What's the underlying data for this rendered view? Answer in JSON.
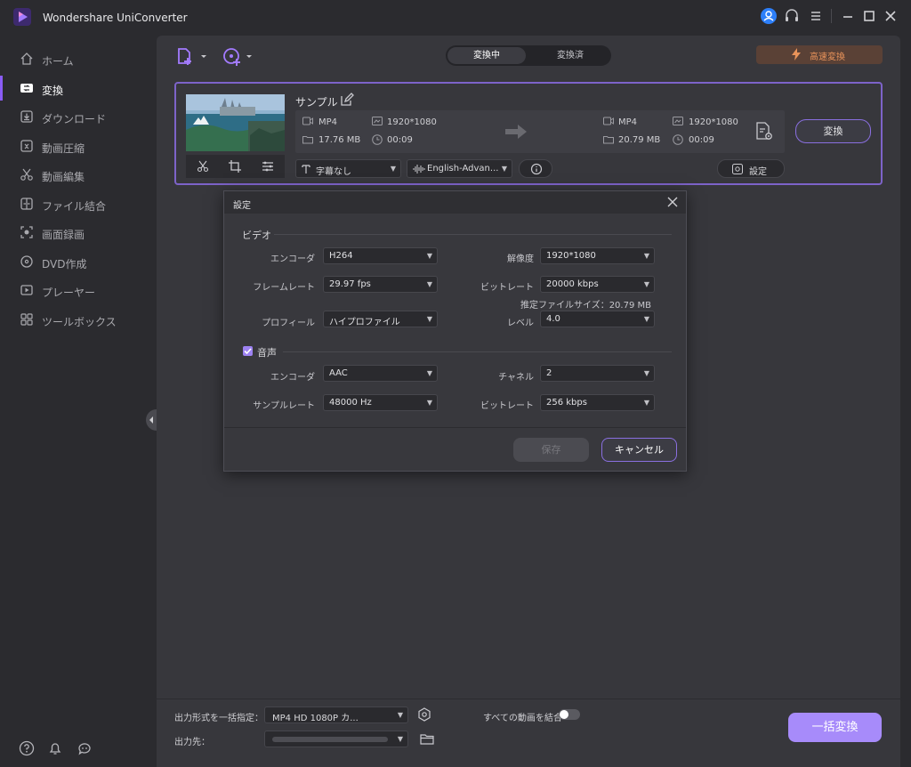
{
  "app": {
    "title": "Wondershare UniConverter"
  },
  "titlebar_icons": [
    "user-icon",
    "headset-icon",
    "menu-icon",
    "minimize-icon",
    "maximize-icon",
    "close-icon"
  ],
  "sidebar": {
    "items": [
      {
        "label": "ホーム",
        "icon": "home-icon"
      },
      {
        "label": "変換",
        "icon": "convert-icon",
        "active": true
      },
      {
        "label": "ダウンロード",
        "icon": "download-icon"
      },
      {
        "label": "動画圧縮",
        "icon": "compress-icon"
      },
      {
        "label": "動画編集",
        "icon": "scissors-icon"
      },
      {
        "label": "ファイル結合",
        "icon": "merge-icon"
      },
      {
        "label": "画面録画",
        "icon": "record-icon"
      },
      {
        "label": "DVD作成",
        "icon": "dvd-icon"
      },
      {
        "label": "プレーヤー",
        "icon": "player-icon"
      },
      {
        "label": "ツールボックス",
        "icon": "toolbox-icon"
      }
    ],
    "bottom_icons": [
      "help-icon",
      "bell-icon",
      "feedback-icon"
    ]
  },
  "toolbar": {
    "tabs": [
      "変換中",
      "変換済"
    ],
    "active_tab": "変換中",
    "turbo_label": "高速変換",
    "accent": "#8a5cf5",
    "turbo_color": "#e8935a"
  },
  "file": {
    "name": "サンプル",
    "source": {
      "format": "MP4",
      "resolution": "1920*1080",
      "size": "17.76 MB",
      "duration": "00:09"
    },
    "target": {
      "format": "MP4",
      "resolution": "1920*1080",
      "size": "20.79 MB",
      "duration": "00:09"
    },
    "convert_label": "変換",
    "subtitle": "字幕なし",
    "audio_track": "English-Advan...",
    "settings_label": "設定"
  },
  "bottom": {
    "output_format_label": "出力形式を一括指定：",
    "output_format_value": "MP4 HD 1080P カ...",
    "output_dir_label": "出力先：",
    "merge_label": "すべての動画を結合",
    "merge_enabled": false,
    "batch_convert_label": "一括変換"
  },
  "dialog": {
    "title": "設定",
    "video_section": "ビデオ",
    "video": {
      "encoder_label": "エンコーダ",
      "encoder": "H264",
      "resolution_label": "解像度",
      "resolution": "1920*1080",
      "framerate_label": "フレームレート",
      "framerate": "29.97 fps",
      "bitrate_label": "ビットレート",
      "bitrate": "20000 kbps",
      "estimated_size": "推定ファイルサイズ：20.79 MB",
      "profile_label": "プロフィール",
      "profile": "ハイプロファイル",
      "level_label": "レベル",
      "level": "4.0"
    },
    "audio_section": "音声",
    "audio_enabled": true,
    "audio": {
      "encoder_label": "エンコーダ",
      "encoder": "AAC",
      "channel_label": "チャネル",
      "channel": "2",
      "samplerate_label": "サンプルレート",
      "samplerate": "48000 Hz",
      "bitrate_label": "ビットレート",
      "bitrate": "256 kbps"
    },
    "save_label": "保存",
    "cancel_label": "キャンセル"
  }
}
